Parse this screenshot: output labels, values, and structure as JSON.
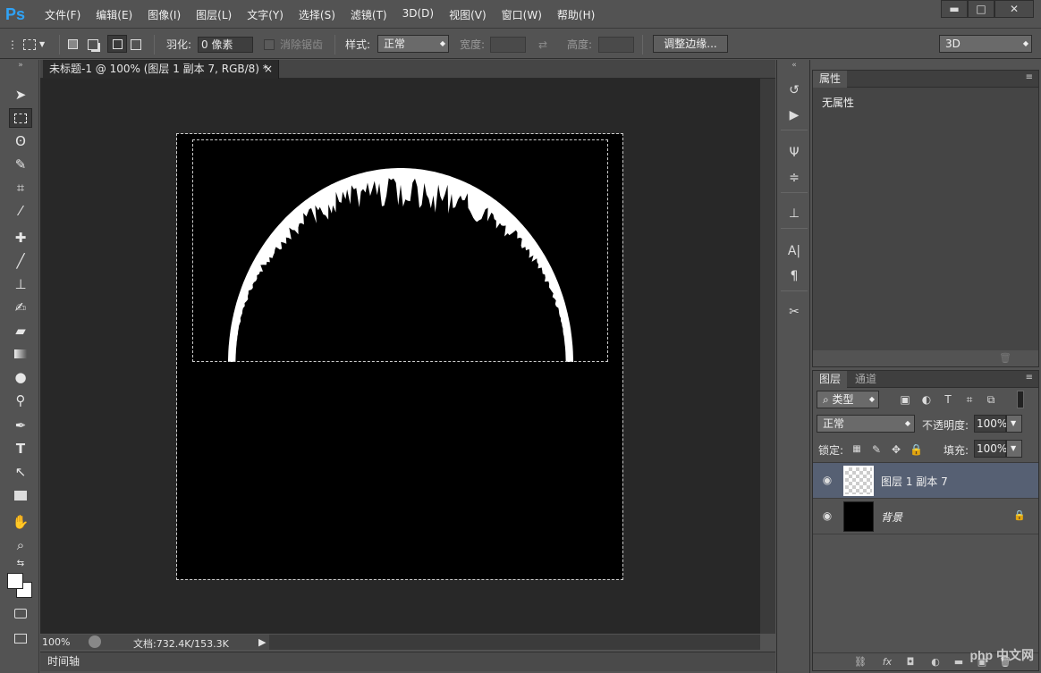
{
  "app": {
    "logo": "Ps"
  },
  "menu": [
    "文件(F)",
    "编辑(E)",
    "图像(I)",
    "图层(L)",
    "文字(Y)",
    "选择(S)",
    "滤镜(T)",
    "3D(D)",
    "视图(V)",
    "窗口(W)",
    "帮助(H)"
  ],
  "window_controls": {
    "minimize": "▬",
    "maximize": "□",
    "close": "✕"
  },
  "options": {
    "feather_label": "羽化:",
    "feather_value": "0 像素",
    "antialias_label": "消除锯齿",
    "style_label": "样式:",
    "style_value": "正常",
    "width_label": "宽度:",
    "height_label": "高度:",
    "refine_edge": "调整边缘...",
    "workspace": "3D"
  },
  "document": {
    "tab_title": "未标题-1 @ 100% (图层 1 副本 7, RGB/8) *",
    "tab_close": "×",
    "zoom": "100%",
    "doc_info": "文档:732.4K/153.3K"
  },
  "timeline_label": "时间轴",
  "properties": {
    "tab": "属性",
    "empty_text": "无属性"
  },
  "layers": {
    "tab_layers": "图层",
    "tab_channels": "通道",
    "filter_kind": "类型",
    "blend_mode": "正常",
    "opacity_label": "不透明度:",
    "opacity_value": "100%",
    "lock_label": "锁定:",
    "fill_label": "填充:",
    "fill_value": "100%",
    "items": [
      {
        "name": "图层 1 副本 7",
        "selected": true,
        "locked": false
      },
      {
        "name": "背景",
        "selected": false,
        "locked": true
      }
    ]
  },
  "watermark": "php 中文网",
  "colors": {
    "canvas": "#000000",
    "selection_row": "#566073",
    "ps_blue": "#2fa3f7"
  }
}
